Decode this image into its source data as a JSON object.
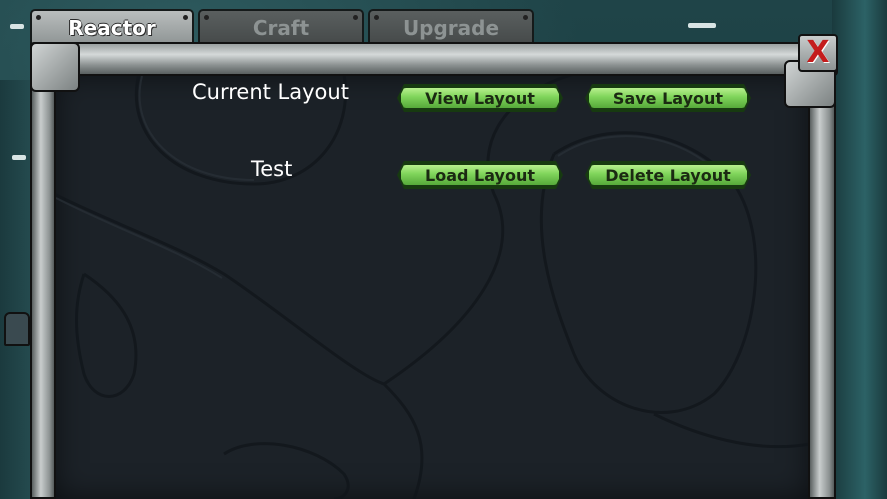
{
  "tabs": [
    {
      "label": "Reactor",
      "active": true
    },
    {
      "label": "Craft",
      "active": false
    },
    {
      "label": "Upgrade",
      "active": false
    }
  ],
  "close_button": {
    "label": "X",
    "icon": "close-icon"
  },
  "layouts": [
    {
      "name": "Current Layout",
      "buttons": [
        {
          "label": "View Layout"
        },
        {
          "label": "Save Layout"
        }
      ]
    },
    {
      "name": "Test",
      "buttons": [
        {
          "label": "Load Layout"
        },
        {
          "label": "Delete Layout"
        }
      ]
    }
  ],
  "colors": {
    "button_green": "#7fd45a",
    "panel_bg": "#1c2228",
    "close_red": "#c41c1c"
  }
}
